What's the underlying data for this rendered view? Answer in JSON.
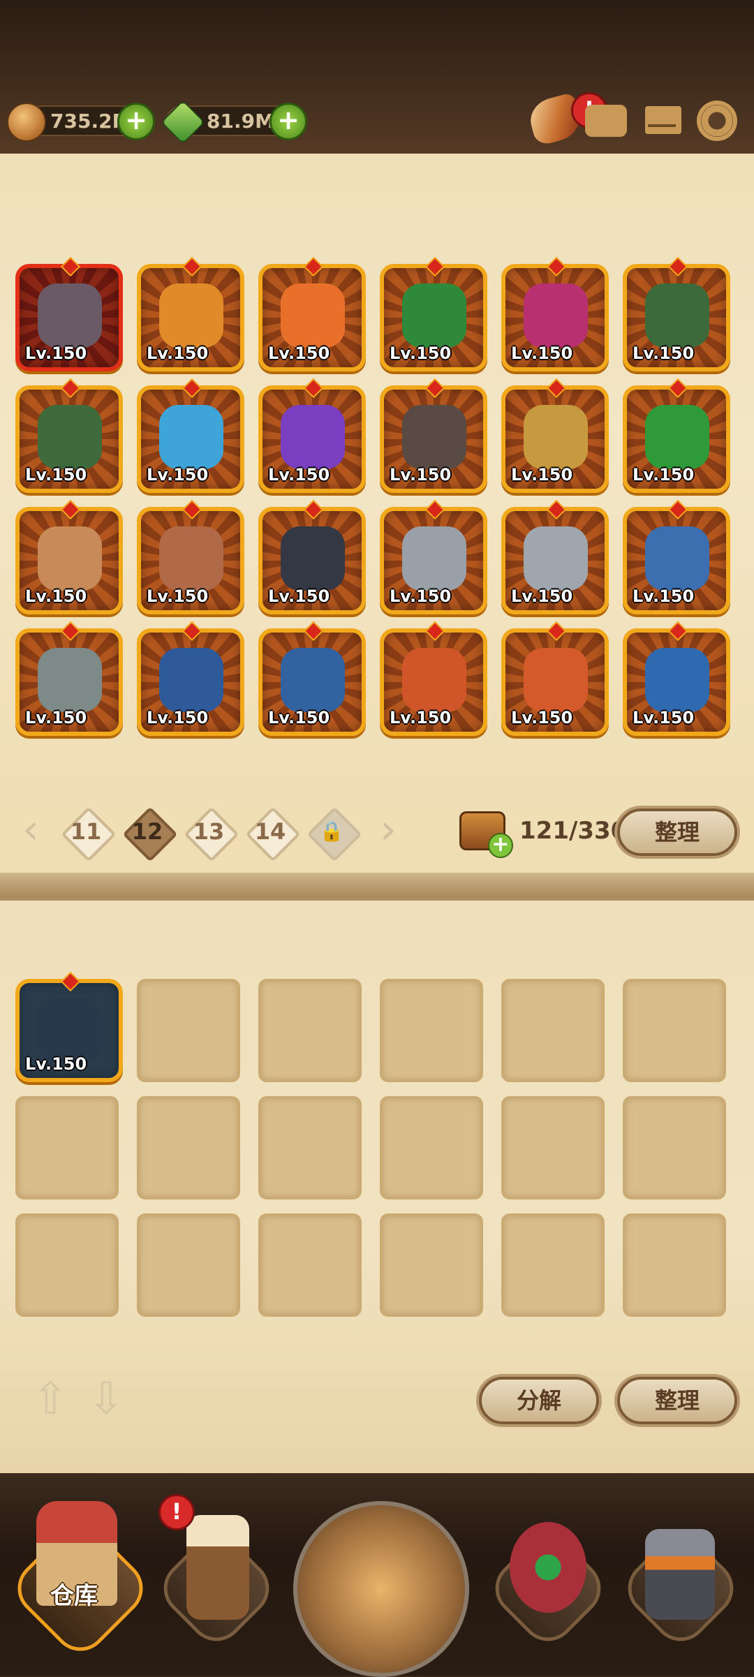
{
  "currency": {
    "gold": "735.2M",
    "gems": "81.9M"
  },
  "top_icons": {
    "alert_mark": "!"
  },
  "inventory": {
    "items": [
      {
        "name": "chains-chest",
        "level": "Lv.150",
        "art": "#6a5a66"
      },
      {
        "name": "fire-sword",
        "level": "Lv.150",
        "art": "#e08a2a"
      },
      {
        "name": "carrot",
        "level": "Lv.150",
        "art": "#e8702a"
      },
      {
        "name": "clover-amulet",
        "level": "Lv.150",
        "art": "#2e8a3a"
      },
      {
        "name": "flower-banner",
        "level": "Lv.150",
        "art": "#b83070"
      },
      {
        "name": "green-tome",
        "level": "Lv.150",
        "art": "#3d6a3a"
      },
      {
        "name": "leaf-tome",
        "level": "Lv.150",
        "art": "#3f6b3c"
      },
      {
        "name": "ice-orb",
        "level": "Lv.150",
        "art": "#3fa5d8"
      },
      {
        "name": "shadow-swirl",
        "level": "Lv.150",
        "art": "#7a3fc0"
      },
      {
        "name": "iron-helm",
        "level": "Lv.150",
        "art": "#5a4a44"
      },
      {
        "name": "ruby-pendant",
        "level": "Lv.150",
        "art": "#c89a40"
      },
      {
        "name": "emerald-pendant",
        "level": "Lv.150",
        "art": "#2e9a3a"
      },
      {
        "name": "spiral-amulet",
        "level": "Lv.150",
        "art": "#c98a5a"
      },
      {
        "name": "plague-mask",
        "level": "Lv.150",
        "art": "#b06a48"
      },
      {
        "name": "dark-glove",
        "level": "Lv.150",
        "art": "#333844"
      },
      {
        "name": "steel-gauntlet",
        "level": "Lv.150",
        "art": "#9aa0a8"
      },
      {
        "name": "steel-gauntlet-2",
        "level": "Lv.150",
        "art": "#a0a6ae"
      },
      {
        "name": "eye-ring",
        "level": "Lv.150",
        "art": "#3b6fb0"
      },
      {
        "name": "plate-armor",
        "level": "Lv.150",
        "art": "#7d8a88"
      },
      {
        "name": "blue-boots",
        "level": "Lv.150",
        "art": "#2f5a9a"
      },
      {
        "name": "blue-boots-2",
        "level": "Lv.150",
        "art": "#3362a0"
      },
      {
        "name": "orange-boots",
        "level": "Lv.150",
        "art": "#d0562a"
      },
      {
        "name": "orange-boots-2",
        "level": "Lv.150",
        "art": "#d45a2c"
      },
      {
        "name": "blue-slipper",
        "level": "Lv.150",
        "art": "#2f6ab0"
      }
    ],
    "pages": [
      "11",
      "12",
      "13",
      "14"
    ],
    "active_page": "12",
    "capacity": "121/330",
    "sort_label": "整理"
  },
  "storage": {
    "items": [
      {
        "name": "dark-cloak",
        "level": "Lv.150",
        "art": "#27394a"
      }
    ],
    "empty_slots": 17,
    "decompose_label": "分解",
    "sort_label": "整理"
  },
  "nav": {
    "warehouse_label": "仓库",
    "alert_mark": "!"
  },
  "colors": {
    "frame_gold": "#f2a81b",
    "frame_red": "#e23018",
    "parchment": "#f1e3c1",
    "plus_green": "#7fc53b",
    "alert_red": "#d92a2a"
  }
}
